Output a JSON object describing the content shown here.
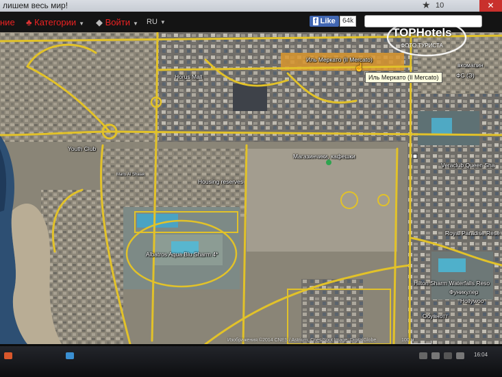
{
  "window": {
    "title": "лишем весь мир!",
    "star_icon": "star-icon",
    "tab_count": "10",
    "close_label": "✕"
  },
  "nav": {
    "items": [
      {
        "label": "ние",
        "caret": ""
      },
      {
        "label": "Категории",
        "caret": "▼"
      },
      {
        "label": "Войти",
        "caret": "▼"
      },
      {
        "label": "RU",
        "caret": "▼"
      }
    ],
    "fb_like": "Like",
    "fb_count": "64k"
  },
  "logo": {
    "brand": "TOPHotels",
    "subtitle": "ФОТО ТУРИСТА"
  },
  "map": {
    "labels": [
      {
        "id": "il-mercato",
        "text": "Иль Меркато (Il Mercato)"
      },
      {
        "id": "horus-mall",
        "text": "Horus Mall"
      },
      {
        "id": "youth-club",
        "text": "Youth Club"
      },
      {
        "id": "magazinchiki",
        "text": "Магазинчики, кафешки"
      },
      {
        "id": "housing-reserves",
        "text": "Housing reserves"
      },
      {
        "id": "albatros",
        "text": "Albatros Aqua Blu Sharm 4*"
      },
      {
        "id": "veraclub",
        "text": "Veraclub Queen Sha"
      },
      {
        "id": "royal-paradise",
        "text": "Royal Paradise Rese"
      },
      {
        "id": "hilton-waterfalls",
        "text": "Hilton Sharm Waterfalls Reso"
      },
      {
        "id": "hollywood",
        "text": "Hollywoo"
      },
      {
        "id": "funikuler",
        "text": "Фуникулер"
      },
      {
        "id": "obuvnoe",
        "text": "Обувнотт"
      },
      {
        "id": "vkomfi",
        "text": "вкомапин"
      },
      {
        "id": "ps",
        "text": "ФС (Э)"
      },
      {
        "id": "maris",
        "text": "Maris Al Shalak"
      }
    ],
    "tooltip": "Иль Меркато (Il Mercato)",
    "attribution": "Изображения ©2014 CNES / Astrium, Cnes/Spot Image, DigitalGlobe",
    "scale": "100 м"
  },
  "taskbar": {
    "clock": "16:04"
  }
}
